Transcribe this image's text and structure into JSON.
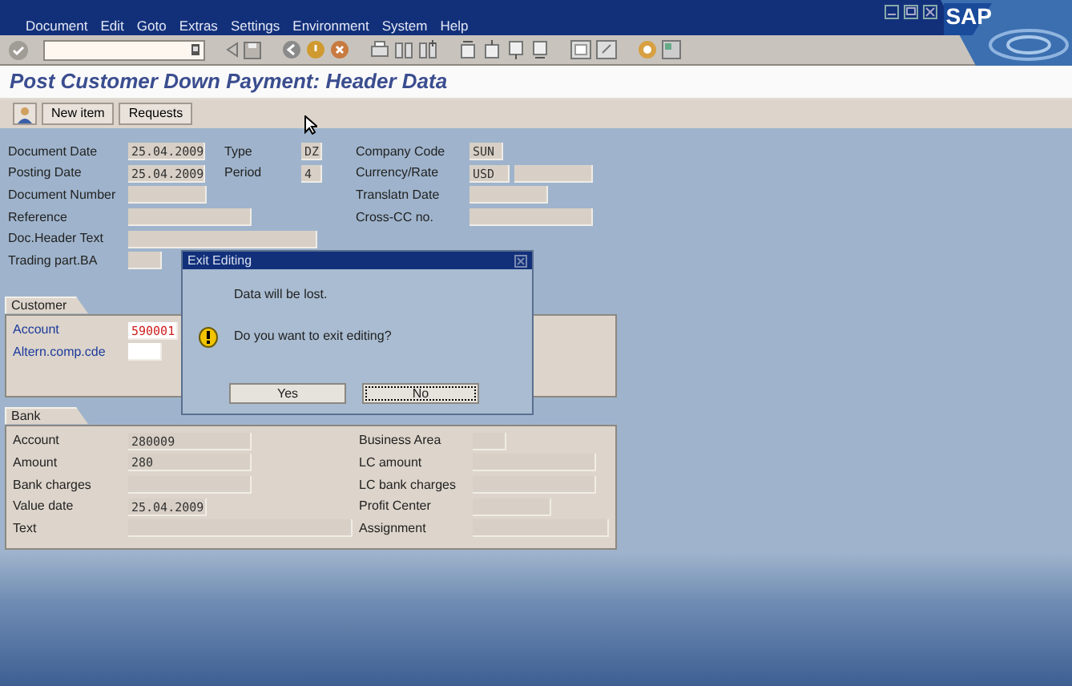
{
  "menu": [
    "Document",
    "Edit",
    "Goto",
    "Extras",
    "Settings",
    "Environment",
    "System",
    "Help"
  ],
  "logo": "SAP",
  "title": "Post Customer Down Payment: Header Data",
  "app_toolbar": [
    "New item",
    "Requests"
  ],
  "header": {
    "left": [
      {
        "label": "Document Date",
        "value": "25.04.2009"
      },
      {
        "label": "Posting Date",
        "value": "25.04.2009"
      },
      {
        "label": "Document Number"
      },
      {
        "label": "Reference"
      },
      {
        "label": "Doc.Header Text"
      },
      {
        "label": "Trading part.BA"
      }
    ],
    "middle": [
      {
        "label": "Type",
        "value": "DZ"
      },
      {
        "label": "Period",
        "value": "4"
      }
    ],
    "right": [
      {
        "label": "Company Code",
        "value": "SUN"
      },
      {
        "label": "Currency/Rate",
        "value": "USD"
      },
      {
        "label": "Translatn Date"
      },
      {
        "label": "Cross-CC no."
      }
    ]
  },
  "customer": {
    "title": "Customer",
    "fields": [
      {
        "label": "Account",
        "value": "590001"
      },
      {
        "label": "Altern.comp.cde"
      }
    ]
  },
  "bank": {
    "title": "Bank",
    "left": [
      {
        "label": "Account",
        "value": "280009"
      },
      {
        "label": "Amount",
        "value": "280"
      },
      {
        "label": "Bank charges"
      },
      {
        "label": "Value date",
        "value": "25.04.2009"
      },
      {
        "label": "Text"
      }
    ],
    "right": [
      {
        "label": "Business Area"
      },
      {
        "label": "LC amount"
      },
      {
        "label": "LC bank charges"
      },
      {
        "label": "Profit Center"
      },
      {
        "label": "Assignment"
      }
    ]
  },
  "dialog": {
    "title": "Exit Editing",
    "lines": [
      "Data will be lost.",
      "Do you want to exit editing?"
    ],
    "buttons": [
      {
        "label": "Yes",
        "focused": false
      },
      {
        "label": "No",
        "focused": true
      }
    ]
  }
}
